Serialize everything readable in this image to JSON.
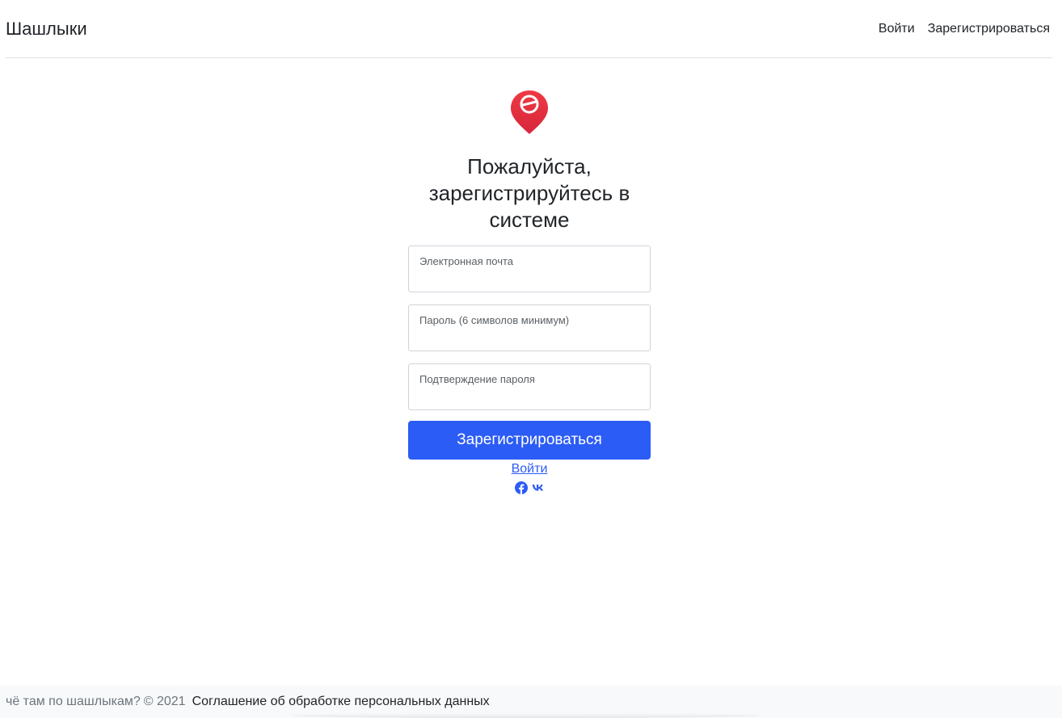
{
  "header": {
    "brand": "Шашлыки",
    "nav": {
      "login": "Войти",
      "register": "Зарегистрироваться"
    }
  },
  "form": {
    "title": "Пожалуйста, зарегистрируйтесь в системе",
    "logo_icon": "map-pin-logo-icon",
    "fields": {
      "email_label": "Электронная почта",
      "password_label": "Пароль (6 символов минимум)",
      "confirm_label": "Подтверждение пароля"
    },
    "submit_label": "Зарегистрироваться",
    "login_link": "Войти",
    "social": [
      "facebook-icon",
      "vk-icon"
    ]
  },
  "footer": {
    "tagline": "чё там по шашлыкам?",
    "copyright": "© 2021",
    "agreement_link": "Соглашение об обработке персональных данных"
  },
  "colors": {
    "accent": "#2c5cf6",
    "logo_red": "#e3303d"
  }
}
